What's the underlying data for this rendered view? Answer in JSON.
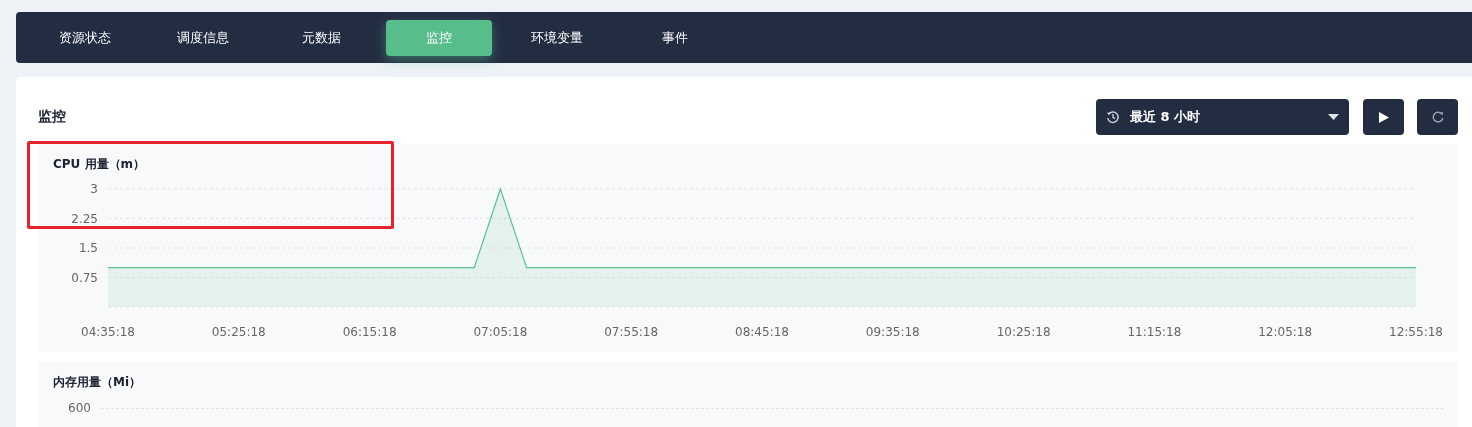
{
  "tabs": [
    {
      "label": "资源状态",
      "selected": false
    },
    {
      "label": "调度信息",
      "selected": false
    },
    {
      "label": "元数据",
      "selected": false
    },
    {
      "label": "监控",
      "selected": true
    },
    {
      "label": "环境变量",
      "selected": false
    },
    {
      "label": "事件",
      "selected": false
    }
  ],
  "panel": {
    "title": "监控",
    "time_range": {
      "value": "最近 8 小时"
    }
  },
  "charts": [
    {
      "highlighted": true,
      "chart_data": {
        "type": "area",
        "title": "CPU 用量（m）",
        "categories": [
          "04:35:18",
          null,
          null,
          null,
          null,
          "05:25:18",
          null,
          null,
          null,
          null,
          "06:15:18",
          null,
          null,
          null,
          null,
          "07:05:18",
          null,
          null,
          null,
          null,
          "07:55:18",
          null,
          null,
          null,
          null,
          "08:45:18",
          null,
          null,
          null,
          null,
          "09:35:18",
          null,
          null,
          null,
          null,
          "10:25:18",
          null,
          null,
          null,
          null,
          "11:15:18",
          null,
          null,
          null,
          null,
          "12:05:18",
          null,
          null,
          null,
          null,
          "12:55:18"
        ],
        "grid": true,
        "series": [
          {
            "color": "#5cc191",
            "values": [
              1,
              1,
              1,
              1,
              1,
              1,
              1,
              1,
              1,
              1,
              1,
              1,
              1,
              1,
              1,
              3,
              1,
              1,
              1,
              1,
              1,
              1,
              1,
              1,
              1,
              1,
              1,
              1,
              1,
              1,
              1,
              1,
              1,
              1,
              1,
              1,
              1,
              1,
              1,
              1,
              1,
              1,
              1,
              1,
              1,
              1,
              1,
              1,
              1,
              1,
              1
            ]
          }
        ],
        "ylim": [
          0,
          3
        ],
        "yticks": [
          {
            "value": 0.75,
            "label": "0.75"
          },
          {
            "value": 1.5,
            "label": "1.5"
          },
          {
            "value": 2.25,
            "label": "2.25"
          },
          {
            "value": 3,
            "label": "3"
          }
        ]
      }
    },
    {
      "highlighted": false,
      "title": "内存用量（Mi）",
      "y_ticks": [
        "600"
      ]
    }
  ]
}
